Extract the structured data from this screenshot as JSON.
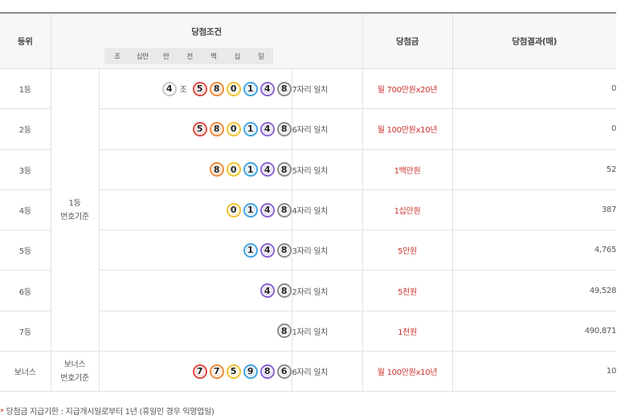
{
  "headers": {
    "rank": "등위",
    "condition": "당첨조건",
    "prize": "당첨금",
    "result": "당첨결과(매)"
  },
  "place_labels": [
    "조",
    "십만",
    "만",
    "천",
    "백",
    "십",
    "일"
  ],
  "unit_jo": "조",
  "base_first": [
    "1등",
    "번호기준"
  ],
  "base_bonus": [
    "보너스",
    "번호기준"
  ],
  "rows": [
    {
      "rank": "1등",
      "jo": "4",
      "digits": [
        "5",
        "8",
        "0",
        "1",
        "4",
        "8"
      ],
      "match": "7자리 일치",
      "prize": "월 700만원x20년",
      "result": "0"
    },
    {
      "rank": "2등",
      "digits": [
        "5",
        "8",
        "0",
        "1",
        "4",
        "8"
      ],
      "match": "6자리 일치",
      "prize": "월 100만원x10년",
      "result": "0"
    },
    {
      "rank": "3등",
      "digits": [
        "8",
        "0",
        "1",
        "4",
        "8"
      ],
      "match": "5자리 일치",
      "prize": "1백만원",
      "result": "52"
    },
    {
      "rank": "4등",
      "digits": [
        "0",
        "1",
        "4",
        "8"
      ],
      "match": "4자리 일치",
      "prize": "1십만원",
      "result": "387"
    },
    {
      "rank": "5등",
      "digits": [
        "1",
        "4",
        "8"
      ],
      "match": "3자리 일치",
      "prize": "5만원",
      "result": "4,765"
    },
    {
      "rank": "6등",
      "digits": [
        "4",
        "8"
      ],
      "match": "2자리 일치",
      "prize": "5천원",
      "result": "49,528"
    },
    {
      "rank": "7등",
      "digits": [
        "8"
      ],
      "match": "1자리 일치",
      "prize": "1천원",
      "result": "490,871"
    },
    {
      "rank": "보너스",
      "digits": [
        "7",
        "7",
        "5",
        "9",
        "8",
        "6"
      ],
      "match": "6자리 일치",
      "prize": "월 100만원x10년",
      "result": "10"
    }
  ],
  "footnote": {
    "star": "*",
    "text": " 당첨금 지급기한 : 지급개시일로부터 1년 (휴일인 경우 익영업일)"
  },
  "colors": {
    "ring_by_position": [
      "#e04a44",
      "#ee8a3a",
      "#f2c230",
      "#41a5e0",
      "#8a63d2",
      "#8c8c8c"
    ],
    "jo_ring": "#c8c8c8",
    "prize_text": "#c8322d",
    "ball_fill": "#ffffff"
  }
}
